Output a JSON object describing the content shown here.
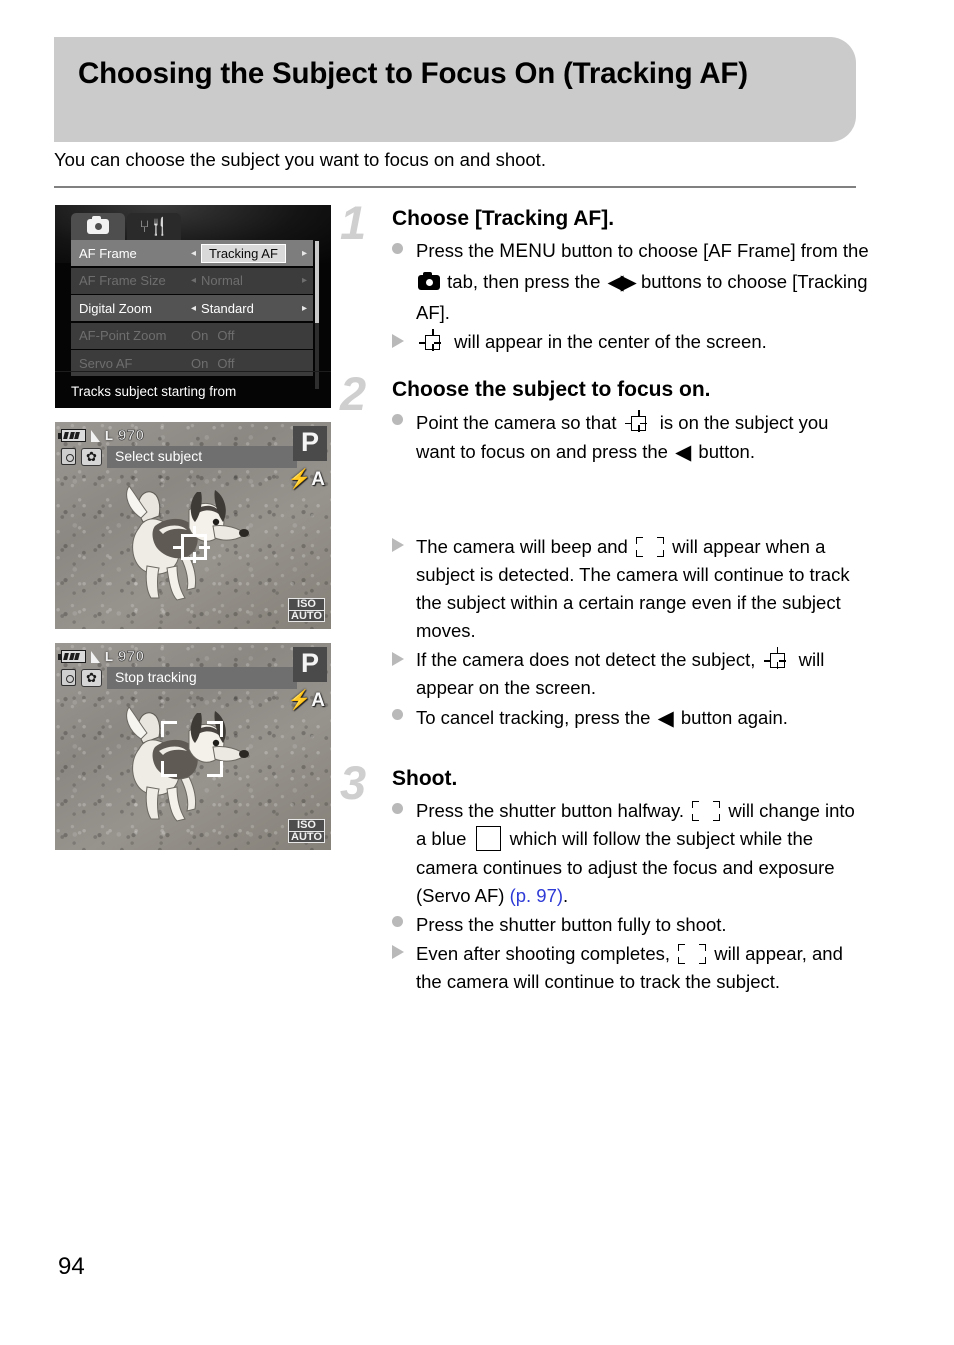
{
  "header": {
    "title": "Choosing the Subject to Focus On (Tracking AF)",
    "intro": "You can choose the subject you want to focus on and shoot."
  },
  "figures": {
    "menu_screen": {
      "tabs": [
        {
          "icon": "camera-icon",
          "state": "active"
        },
        {
          "icon": "wrench-tools-icon",
          "state": "inactive"
        }
      ],
      "rows": [
        {
          "label": "AF Frame",
          "value": "Tracking AF",
          "state": "selected",
          "left_arrow": "◂",
          "right_arrow": "▸"
        },
        {
          "label": "AF Frame Size",
          "value": "Normal",
          "state": "dimmed",
          "left_arrow": "◂",
          "right_arrow": "▸"
        },
        {
          "label": "Digital Zoom",
          "value": "Standard",
          "state": "normal",
          "left_arrow": "◂",
          "right_arrow": "▸"
        },
        {
          "label": "AF-Point Zoom",
          "value": "",
          "state": "dimmed",
          "options": [
            "On",
            "Off"
          ]
        },
        {
          "label": "Servo AF",
          "value": "",
          "state": "dimmed",
          "options": [
            "On",
            "Off"
          ]
        }
      ],
      "hint": "Tracks subject starting from"
    },
    "lcd_select": {
      "battery": "battery-full-icon",
      "quality": "L",
      "shots_remaining": "970",
      "timer_icon": "self-timer-icon",
      "macro_icon": "macro-flower-icon",
      "message": "Select subject",
      "mode": "P",
      "flash": "flash-auto-icon",
      "iso_line1": "ISO",
      "iso_line2": "AUTO",
      "af_frame": "af-crosshair-frame"
    },
    "lcd_tracking": {
      "battery": "battery-full-icon",
      "quality": "L",
      "shots_remaining": "970",
      "timer_icon": "self-timer-icon",
      "macro_icon": "macro-flower-icon",
      "message": "Stop tracking",
      "mode": "P",
      "flash": "flash-auto-icon",
      "iso_line1": "ISO",
      "iso_line2": "AUTO",
      "af_frame": "af-corner-brackets"
    }
  },
  "steps": [
    {
      "number": "1",
      "heading": "Choose [Tracking AF].",
      "bullets": [
        {
          "marker": "dot",
          "parts": [
            {
              "t": "text",
              "v": "Press the "
            },
            {
              "t": "glyph",
              "v": "MENU"
            },
            {
              "t": "text",
              "v": " button to choose [AF Frame] from the "
            },
            {
              "t": "glyph",
              "v": "camera-icon"
            },
            {
              "t": "text",
              "v": " tab, then press the "
            },
            {
              "t": "glyph",
              "v": "left-right-buttons"
            },
            {
              "t": "text",
              "v": " buttons to choose [Tracking AF]."
            }
          ],
          "text_1": "Press the ",
          "menu_label": "MENU",
          "text_2": " button to choose [AF Frame] from the ",
          "text_3": " tab, then press the ",
          "text_4": " buttons to choose [Tracking AF]."
        },
        {
          "marker": "triangle",
          "text_1": " will appear in the center of the screen."
        }
      ]
    },
    {
      "number": "2",
      "heading": "Choose the subject to focus on.",
      "bullets": [
        {
          "marker": "dot",
          "text_1": "Point the camera so that ",
          "text_2": " is on the subject you want to focus on and press the ",
          "text_3": " button."
        }
      ]
    },
    {
      "number": "",
      "heading": "",
      "bullets": [
        {
          "marker": "triangle",
          "text_1": "The camera will beep and ",
          "text_2": " will appear when a subject is detected. The camera will continue to track the subject within a certain range even if the subject moves."
        },
        {
          "marker": "triangle",
          "text_1": "If the camera does not detect the subject, ",
          "text_2": " will appear on the screen."
        },
        {
          "marker": "dot",
          "text_1": "To cancel tracking, press the ",
          "text_2": " button again."
        }
      ]
    },
    {
      "number": "3",
      "heading": "Shoot.",
      "bullets": [
        {
          "marker": "dot",
          "text_1": "Press the shutter button halfway. ",
          "text_2": " will change into a blue ",
          "text_3": " which will follow the subject while the camera continues to adjust the focus and exposure (Servo AF) ",
          "link": "(p. 97)",
          "text_4": "."
        },
        {
          "marker": "dot",
          "text_1": "Press the shutter button fully to shoot."
        },
        {
          "marker": "triangle",
          "text_1": "Even after shooting completes, ",
          "text_2": " will appear, and the camera will continue to track the subject."
        }
      ]
    }
  ],
  "page_number": "94",
  "colors": {
    "header_bg": "#cbcbcb",
    "link": "#2f3bd6",
    "step_number": "#cfcfcf",
    "bullet_marker": "#b9b9b9"
  }
}
